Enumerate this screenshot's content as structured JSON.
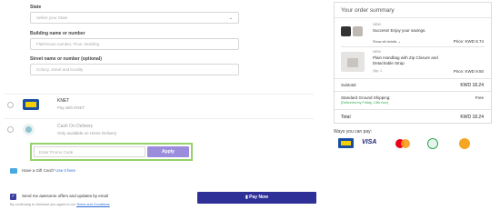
{
  "form": {
    "state_label": "State",
    "state_placeholder": "Select your State",
    "building_label": "Building name or number",
    "building_placeholder": "Flat/House number, Floor, Building",
    "street_label": "Street name or number (optional)",
    "street_placeholder": "Colony, street and locality"
  },
  "payment_methods": [
    {
      "title": "KNET",
      "subtitle": "Pay with KNET"
    },
    {
      "title": "Cash On Delivery",
      "subtitle": "Only available on Home Delivery"
    }
  ],
  "promo": {
    "placeholder": "Enter Promo Code",
    "apply_label": "Apply"
  },
  "gift_card": {
    "text": "Have a Gift Card?",
    "link": "Use it here"
  },
  "offers": {
    "label": "Send me awesome offers and updates by email",
    "terms_prefix": "By continuing to checkout you agree to our",
    "terms_link": "Terms and Conditions"
  },
  "pay_now_label": "Pay Now",
  "summary": {
    "title": "Your order summary",
    "item1": {
      "tag": "NEW",
      "title": "Success! Enjoy your savings.",
      "link": "Show all details",
      "price": "Price: KWD 8.74"
    },
    "item2": {
      "tag": "NEW",
      "title": "Plain Handbag with Zip Closure and Detachable Strap",
      "qty": "Qty: 1",
      "price": "Price: KWD 9.50"
    },
    "subtotal_label": "Subtotal",
    "subtotal_value": "KWD 18.24",
    "shipping_label": "Standard Ground Shipping:",
    "shipping_note": "(Delivered by Friday, 13th Nov)",
    "shipping_value": "Free",
    "total_label": "Total",
    "total_value": "KWD 18.24"
  },
  "ways_to_pay": {
    "title": "Ways you can pay:",
    "methods": [
      "KNET",
      "VISA",
      "Mastercard",
      "Cash on delivery",
      "Wallet"
    ]
  },
  "colors": {
    "accent": "#2e2f97",
    "apply": "#9b8ddb",
    "promo_border": "#93d36b",
    "visa": "#1a1f71",
    "green": "#2fa84f"
  }
}
